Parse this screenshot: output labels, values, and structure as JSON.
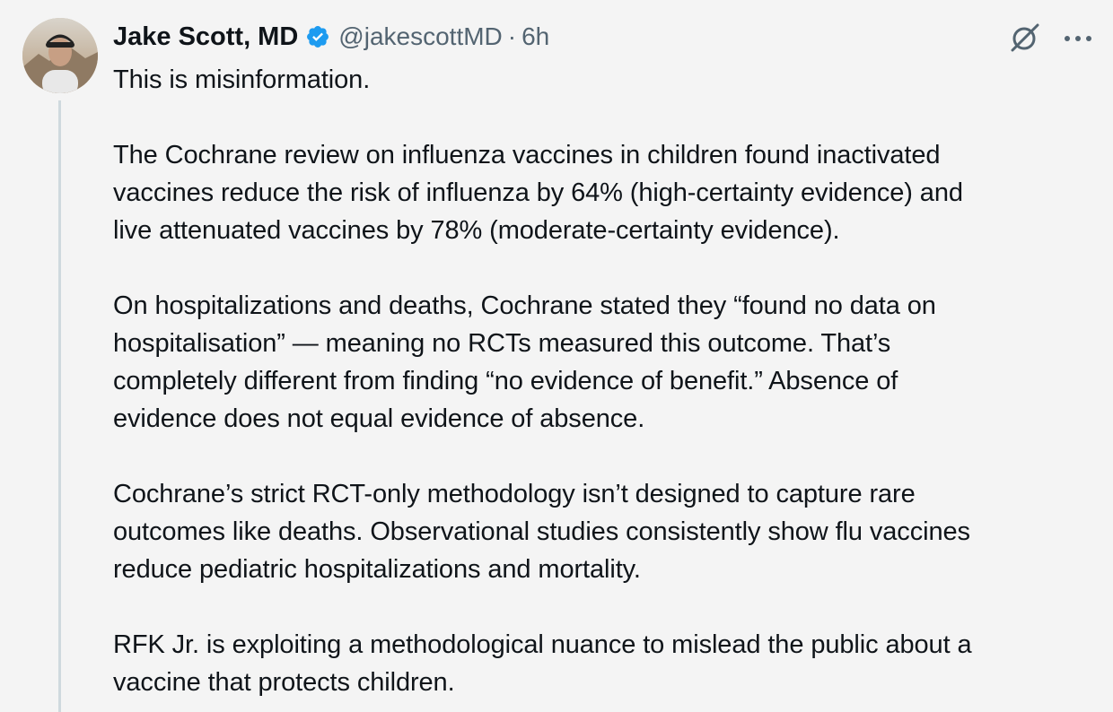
{
  "tweet": {
    "author_name": "Jake Scott, MD",
    "handle": "@jakescottMD",
    "separator": "·",
    "time": "6h",
    "verified": true,
    "icons": {
      "grok": "grok-icon",
      "more": "more-options-icon",
      "badge": "verified-badge-icon"
    },
    "colors": {
      "verified": "#1d9bf0",
      "text": "#0f1419",
      "secondary": "#536471"
    },
    "paragraphs": [
      [
        "This is misinformation."
      ],
      [
        "The Cochrane review on influenza vaccines in children found inactivated",
        "vaccines reduce the risk of influenza by 64% (high-certainty evidence) and",
        "live attenuated vaccines by 78% (moderate-certainty evidence)."
      ],
      [
        "On hospitalizations and deaths, Cochrane stated they “found no data on",
        "hospitalisation” — meaning no RCTs measured this outcome. That’s",
        "completely different from finding “no evidence of benefit.” Absence of",
        "evidence does not equal evidence of absence."
      ],
      [
        "Cochrane’s strict RCT-only methodology isn’t designed to capture rare",
        "outcomes like deaths. Observational studies consistently show flu vaccines",
        "reduce pediatric hospitalizations and mortality."
      ],
      [
        "RFK Jr. is exploiting a methodological nuance to mislead the public about a",
        "vaccine that protects children."
      ]
    ]
  }
}
